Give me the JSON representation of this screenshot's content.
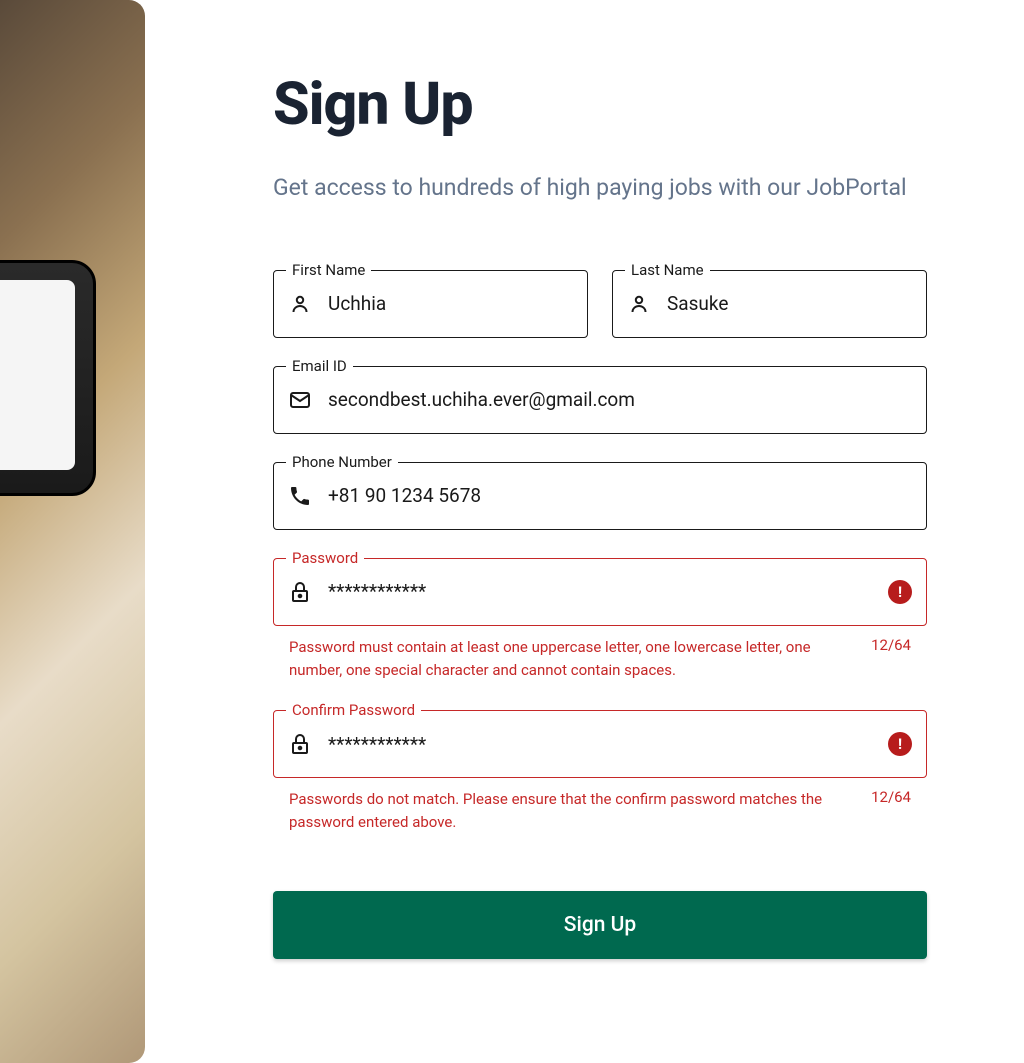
{
  "title": "Sign Up",
  "subtitle": "Get access to hundreds of high paying jobs with our JobPortal",
  "fields": {
    "firstName": {
      "label": "First Name",
      "value": "Uchhia"
    },
    "lastName": {
      "label": "Last Name",
      "value": "Sasuke"
    },
    "email": {
      "label": "Email ID",
      "value": "secondbest.uchiha.ever@gmail.com"
    },
    "phone": {
      "label": "Phone Number",
      "value": "+81 90 1234 5678"
    },
    "password": {
      "label": "Password",
      "value": "************",
      "error": "Password must contain at least one uppercase letter, one lowercase letter, one number, one special character and cannot contain spaces.",
      "counter": "12/64"
    },
    "confirmPassword": {
      "label": "Confirm Password",
      "value": "************",
      "error": "Passwords do not match. Please ensure that the confirm password matches the password entered above.",
      "counter": "12/64"
    }
  },
  "submitLabel": "Sign Up"
}
